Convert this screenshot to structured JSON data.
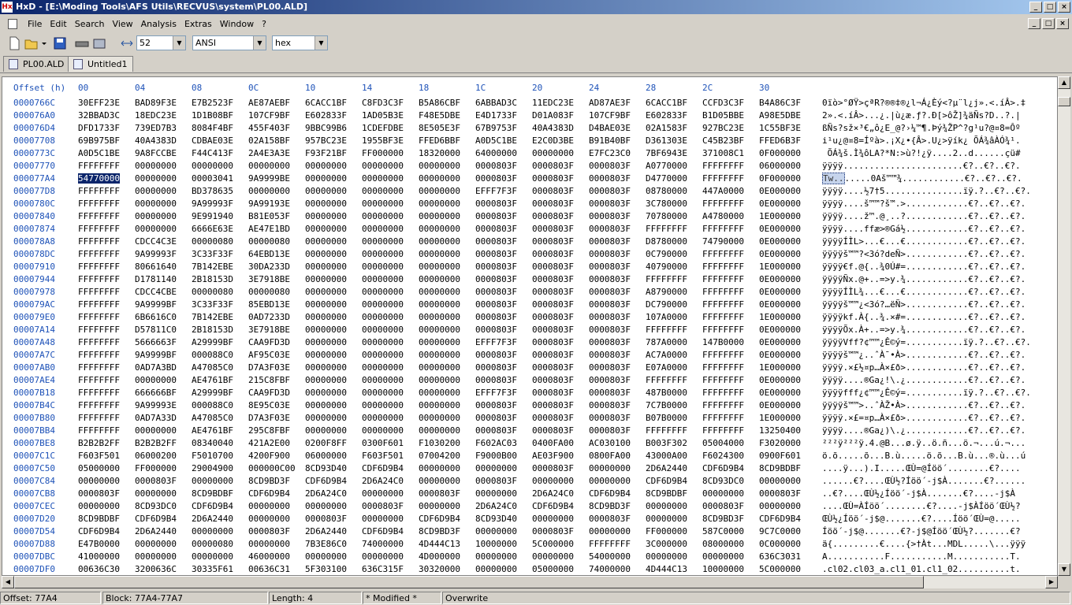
{
  "window": {
    "title": "HxD - [E:\\Moding Tools\\AFS Utils\\RECVUS\\system\\PL00.ALD]"
  },
  "menu": [
    "File",
    "Edit",
    "Search",
    "View",
    "Analysis",
    "Extras",
    "Window",
    "?"
  ],
  "toolbar": {
    "bytes_per_row": "52",
    "charset": "ANSI",
    "offset_base": "hex"
  },
  "tabs": [
    {
      "label": "PL00.ALD",
      "active": true
    },
    {
      "label": "Untitled1",
      "active": false
    }
  ],
  "editor": {
    "header": {
      "offset_label": "Offset (h)",
      "cols": [
        "00",
        "04",
        "08",
        "0C",
        "10",
        "14",
        "18",
        "1C",
        "20",
        "24",
        "28",
        "2C",
        "30"
      ]
    },
    "selected": {
      "row": 2,
      "col": 0,
      "text_sel": "Tw.."
    },
    "rows": [
      {
        "o": "0000766C",
        "h": [
          "30EFF23E",
          "BAD89F3E",
          "E7B2523F",
          "AE87AEBF",
          "6CACC1BF",
          "C8FD3C3F",
          "B5A86CBF",
          "6ABBAD3C",
          "11EDC23E",
          "AD87AE3F",
          "6CACC1BF",
          "CCFD3C3F",
          "B4A86C3F"
        ],
        "t": "0ïò>°ØŸ>çªR?®®‡®¿l¬Á¿Èý<?µ¨l¿j».<.íÂ>.‡"
      },
      {
        "o": "000076A0",
        "h": [
          "32BBAD3C",
          "18EDC23E",
          "1D1B08BF",
          "107CF9BF",
          "E602833F",
          "1AD05B3E",
          "F48E5DBE",
          "E4D1733F",
          "D01A083F",
          "107CF9BF",
          "E602833F",
          "B1D05BBE",
          "A98E5DBE"
        ],
        "t": "2».<.íÂ>...¿.|ù¿æ.ƒ?.Ð[>ôŽ]¾äÑs?D..?.|"
      },
      {
        "o": "000076D4",
        "h": [
          "DFD1733F",
          "739ED7B3",
          "8084F4BF",
          "455F403F",
          "9BBC99B6",
          "1CDEFDBE",
          "8E505E3F",
          "67B9753F",
          "40A4383D",
          "D4BAE03E",
          "02A1583F",
          "927BC23E",
          "1C55BF3E"
        ],
        "t": "ßÑs?sž×³€„ô¿E_@?›¼™¶.Þý¾ŽP^?g¹u?@¤8=Ôº"
      },
      {
        "o": "00007708",
        "h": [
          "69B975BF",
          "40A4383D",
          "CDBAE03E",
          "02A158BF",
          "957BC23E",
          "1955BF3E",
          "FFED6BBF",
          "A0D5C1BE",
          "E2C0D3BE",
          "B91B40BF",
          "D361303E",
          "C45B23BF",
          "FFED6B3F"
        ],
        "t": "i¹u¿@¤8=Íºà>.¡X¿•{Â>.U¿>ÿík¿ ÕÁ¾âÀÓ¾¹."
      },
      {
        "o": "0000773C",
        "h": [
          "A0D5C1BE",
          "9A8FCCBE",
          "F44C413F",
          "2A4E3A3E",
          "F93F21BF",
          "FF000000",
          "18320000",
          "64000000",
          "00000000",
          "E7FC23C0",
          "7BF6943E",
          "371008C1",
          "0F000000"
        ],
        "t": " ÕÁ¾š.Ì¾ôLA?*N:>ù?!¿ÿ....2..d......çü#"
      },
      {
        "o": "00007770",
        "h": [
          "FFFFFFFF",
          "00000000",
          "00000000",
          "00000000",
          "00000000",
          "00000000",
          "00000000",
          "0000803F",
          "0000803F",
          "0000803F",
          "A0770000",
          "FFFFFFFF",
          "06000000"
        ],
        "t": "ÿÿÿÿ.......................€?..€?..€?."
      },
      {
        "o": "000077A4",
        "h": [
          "54770000",
          "00000000",
          "00003041",
          "9A9999BE",
          "00000000",
          "00000000",
          "00000000",
          "0000803F",
          "0000803F",
          "0000803F",
          "D4770000",
          "FFFFFFFF",
          "0F000000"
        ],
        "t": "Tw.......0Aš™™¾............€?..€?..€?."
      },
      {
        "o": "000077D8",
        "h": [
          "FFFFFFFF",
          "00000000",
          "BD378635",
          "00000000",
          "00000000",
          "00000000",
          "00000000",
          "EFFF7F3F",
          "0000803F",
          "0000803F",
          "08780000",
          "447A0000",
          "0E000000"
        ],
        "t": "ÿÿÿÿ....½7†5...............ïÿ.?..€?..€?."
      },
      {
        "o": "0000780C",
        "h": [
          "FFFFFFFF",
          "00000000",
          "9A99993F",
          "9A99193E",
          "00000000",
          "00000000",
          "00000000",
          "0000803F",
          "0000803F",
          "0000803F",
          "3C780000",
          "FFFFFFFF",
          "0E000000"
        ],
        "t": "ÿÿÿÿ....š™™?š™.>............€?..€?..€?."
      },
      {
        "o": "00007840",
        "h": [
          "FFFFFFFF",
          "00000000",
          "9E991940",
          "B81E053F",
          "00000000",
          "00000000",
          "00000000",
          "0000803F",
          "0000803F",
          "0000803F",
          "70780000",
          "A4780000",
          "1E000000"
        ],
        "t": "ÿÿÿÿ....ž™.@¸..?............€?..€?..€?."
      },
      {
        "o": "00007874",
        "h": [
          "FFFFFFFF",
          "00000000",
          "6666E63E",
          "AE47E1BD",
          "00000000",
          "00000000",
          "00000000",
          "0000803F",
          "0000803F",
          "0000803F",
          "FFFFFFFF",
          "FFFFFFFF",
          "0E000000"
        ],
        "t": "ÿÿÿÿ....ffæ>®Gá½............€?..€?..€?."
      },
      {
        "o": "000078A8",
        "h": [
          "FFFFFFFF",
          "CDCC4C3E",
          "00000080",
          "00000080",
          "00000000",
          "00000000",
          "00000000",
          "0000803F",
          "0000803F",
          "0000803F",
          "D8780000",
          "74790000",
          "0E000000"
        ],
        "t": "ÿÿÿÿÍÌL>...€...€............€?..€?..€?."
      },
      {
        "o": "000078DC",
        "h": [
          "FFFFFFFF",
          "9A99993F",
          "3C33F33F",
          "64EBD13E",
          "00000000",
          "00000000",
          "00000000",
          "0000803F",
          "0000803F",
          "0000803F",
          "0C790000",
          "FFFFFFFF",
          "0E000000"
        ],
        "t": "ÿÿÿÿš™™?<3ó?deÑ>............€?..€?..€?."
      },
      {
        "o": "00007910",
        "h": [
          "FFFFFFFF",
          "80661640",
          "7B142EBE",
          "30DA233D",
          "00000000",
          "00000000",
          "00000000",
          "0000803F",
          "0000803F",
          "0000803F",
          "40790000",
          "FFFFFFFF",
          "1E000000"
        ],
        "t": "ÿÿÿÿ€f.@{..¾0Ú#=............€?..€?..€?."
      },
      {
        "o": "00007944",
        "h": [
          "FFFFFFFF",
          "D1781140",
          "2B18153D",
          "3E7918BE",
          "00000000",
          "00000000",
          "00000000",
          "0000803F",
          "0000803F",
          "0000803F",
          "FFFFFFFF",
          "FFFFFFFF",
          "0E000000"
        ],
        "t": "ÿÿÿÿÑx.@+..=>y.¾............€?..€?..€?."
      },
      {
        "o": "00007978",
        "h": [
          "FFFFFFFF",
          "CDCC4CBE",
          "00000080",
          "00000080",
          "00000000",
          "00000000",
          "00000000",
          "0000803F",
          "0000803F",
          "0000803F",
          "A8790000",
          "FFFFFFFF",
          "0E000000"
        ],
        "t": "ÿÿÿÿÍÌL¾...€...€............€?..€?..€?."
      },
      {
        "o": "000079AC",
        "h": [
          "FFFFFFFF",
          "9A9999BF",
          "3C33F33F",
          "85EBD13E",
          "00000000",
          "00000000",
          "00000000",
          "0000803F",
          "0000803F",
          "0000803F",
          "DC790000",
          "FFFFFFFF",
          "0E000000"
        ],
        "t": "ÿÿÿÿš™™¿<3ó?…ëÑ>............€?..€?..€?."
      },
      {
        "o": "000079E0",
        "h": [
          "FFFFFFFF",
          "6B6616C0",
          "7B142EBE",
          "0AD7233D",
          "00000000",
          "00000000",
          "00000000",
          "0000803F",
          "0000803F",
          "0000803F",
          "107A0000",
          "FFFFFFFF",
          "1E000000"
        ],
        "t": "ÿÿÿÿkf.À{..¾.×#=............€?..€?..€?."
      },
      {
        "o": "00007A14",
        "h": [
          "FFFFFFFF",
          "D57811C0",
          "2B18153D",
          "3E7918BE",
          "00000000",
          "00000000",
          "00000000",
          "0000803F",
          "0000803F",
          "0000803F",
          "FFFFFFFF",
          "FFFFFFFF",
          "0E000000"
        ],
        "t": "ÿÿÿÿÕx.À+..=>y.¾............€?..€?..€?."
      },
      {
        "o": "00007A48",
        "h": [
          "FFFFFFFF",
          "5666663F",
          "A29999BF",
          "CAA9FD3D",
          "00000000",
          "00000000",
          "00000000",
          "EFFF7F3F",
          "0000803F",
          "0000803F",
          "787A0000",
          "147B0000",
          "0E000000"
        ],
        "t": "ÿÿÿÿVff?¢™™¿Ê©ý=...........ïÿ.?..€?..€?."
      },
      {
        "o": "00007A7C",
        "h": [
          "FFFFFFFF",
          "9A9999BF",
          "000088C0",
          "AF95C03E",
          "00000000",
          "00000000",
          "00000000",
          "0000803F",
          "0000803F",
          "0000803F",
          "AC7A0000",
          "FFFFFFFF",
          "0E000000"
        ],
        "t": "ÿÿÿÿš™™¿..ˆÀ¯•À>............€?..€?..€?."
      },
      {
        "o": "00007AB0",
        "h": [
          "FFFFFFFF",
          "0AD7A3BD",
          "A47085C0",
          "D7A3F03E",
          "00000000",
          "00000000",
          "00000000",
          "0000803F",
          "0000803F",
          "0000803F",
          "E07A0000",
          "FFFFFFFF",
          "1E000000"
        ],
        "t": "ÿÿÿÿ.×£½¤p…À×£ð>............€?..€?..€?."
      },
      {
        "o": "00007AE4",
        "h": [
          "FFFFFFFF",
          "00000000",
          "AE4761BF",
          "215C8FBF",
          "00000000",
          "00000000",
          "00000000",
          "0000803F",
          "0000803F",
          "0000803F",
          "FFFFFFFF",
          "FFFFFFFF",
          "0E000000"
        ],
        "t": "ÿÿÿÿ....®Ga¿!\\.¿............€?..€?..€?."
      },
      {
        "o": "00007B18",
        "h": [
          "FFFFFFFF",
          "666666BF",
          "A29999BF",
          "CAA9FD3D",
          "00000000",
          "00000000",
          "00000000",
          "EFFF7F3F",
          "0000803F",
          "0000803F",
          "487B0000",
          "FFFFFFFF",
          "0E000000"
        ],
        "t": "ÿÿÿÿfff¿¢™™¿Ê©ý=...........ïÿ.?..€?..€?."
      },
      {
        "o": "00007B4C",
        "h": [
          "FFFFFFFF",
          "9A99993E",
          "000088C0",
          "8E95C03E",
          "00000000",
          "00000000",
          "00000000",
          "0000803F",
          "0000803F",
          "0000803F",
          "7C7B0000",
          "FFFFFFFF",
          "0E000000"
        ],
        "t": "ÿÿÿÿš™™>..ˆÀŽ•À>............€?..€?..€?."
      },
      {
        "o": "00007B80",
        "h": [
          "FFFFFFFF",
          "0AD7A33D",
          "A47085C0",
          "D7A3F03E",
          "00000000",
          "00000000",
          "00000000",
          "0000803F",
          "0000803F",
          "0000803F",
          "B07B0000",
          "FFFFFFFF",
          "1E000000"
        ],
        "t": "ÿÿÿÿ.×£=¤p…À×£ð>............€?..€?..€?."
      },
      {
        "o": "00007BB4",
        "h": [
          "FFFFFFFF",
          "00000000",
          "AE4761BF",
          "295C8FBF",
          "00000000",
          "00000000",
          "00000000",
          "0000803F",
          "0000803F",
          "0000803F",
          "FFFFFFFF",
          "FFFFFFFF",
          "13250400"
        ],
        "t": "ÿÿÿÿ....®Ga¿)\\.¿............€?..€?..€?."
      },
      {
        "o": "00007BE8",
        "h": [
          "B2B2B2FF",
          "B2B2B2FF",
          "08340040",
          "421A2E00",
          "0200F8FF",
          "0300F601",
          "F1030200",
          "F602AC03",
          "0400FA00",
          "AC030100",
          "B003F302",
          "05004000",
          "F3020000"
        ],
        "t": "²²²ÿ²²²ÿ.4.@B...ø.ÿ..ö.ñ...ö.¬...ú.¬..."
      },
      {
        "o": "00007C1C",
        "h": [
          "F603F501",
          "06000200",
          "F5010700",
          "4200F900",
          "06000000",
          "F603F501",
          "07004200",
          "F9000B00",
          "AE03F900",
          "0800FA00",
          "43000A00",
          "F6024300",
          "0900F601"
        ],
        "t": "ö.õ.....õ...B.ù.....ö.õ...B.ù...®.ù...ú"
      },
      {
        "o": "00007C50",
        "h": [
          "05000000",
          "FF000000",
          "29004900",
          "000000C00",
          "8CD93D40",
          "CDF6D9B4",
          "00000000",
          "00000000",
          "0000803F",
          "00000000",
          "2D6A2440",
          "CDF6D9B4",
          "8CD9BDBF"
        ],
        "t": "....ÿ...).I.....ŒÙ=@Íöö´........€?...."
      },
      {
        "o": "00007C84",
        "h": [
          "00000000",
          "0000803F",
          "00000000",
          "8CD9BD3F",
          "CDF6D9B4",
          "2D6A24C0",
          "00000000",
          "0000803F",
          "00000000",
          "00000000",
          "CDF6D9B4",
          "8CD93DC0",
          "00000000"
        ],
        "t": "......€?....ŒÙ½?Íöö´-j$À.......€?......"
      },
      {
        "o": "00007CB8",
        "h": [
          "0000803F",
          "00000000",
          "8CD9BDBF",
          "CDF6D9B4",
          "2D6A24C0",
          "00000000",
          "0000803F",
          "00000000",
          "2D6A24C0",
          "CDF6D9B4",
          "8CD9BDBF",
          "00000000",
          "0000803F"
        ],
        "t": "..€?....ŒÙ½¿Íöö´-j$À.......€?....-j$À"
      },
      {
        "o": "00007CEC",
        "h": [
          "00000000",
          "8CD93DC0",
          "CDF6D9B4",
          "00000000",
          "00000000",
          "0000803F",
          "00000000",
          "2D6A24C0",
          "CDF6D9B4",
          "8CD9BD3F",
          "00000000",
          "0000803F",
          "00000000"
        ],
        "t": "....ŒÙ=ÀÍöö´........€?....-j$ÀÍöö´ŒÙ½?"
      },
      {
        "o": "00007D20",
        "h": [
          "8CD9BDBF",
          "CDF6D9B4",
          "2D6A2440",
          "00000000",
          "0000803F",
          "00000000",
          "CDF6D9B4",
          "8CD93D40",
          "00000000",
          "0000803F",
          "00000000",
          "8CD9BD3F",
          "CDF6D9B4"
        ],
        "t": "ŒÙ½¿Íöö´-j$@.......€?....Íöö´ŒÙ=@....."
      },
      {
        "o": "00007D54",
        "h": [
          "CDF6D9B4",
          "2D6A2440",
          "00000000",
          "0000803F",
          "2D6A2440",
          "CDF6D9B4",
          "8CD9BD3F",
          "00000000",
          "0000803F",
          "00000000",
          "FF000000",
          "587C0000",
          "9C7C0000"
        ],
        "t": "Íöö´-j$@.......€?-j$@Íöö´ŒÙ½?.......€?"
      },
      {
        "o": "00007D88",
        "h": [
          "E47B0000",
          "00000000",
          "00000080",
          "00000000",
          "7B3E86C0",
          "74000000",
          "4D444C13",
          "10000000",
          "5C000000",
          "FFFFFFFF",
          "3C000000",
          "08000000",
          "0C000000"
        ],
        "t": "ä{.........€....{>†Àt...MDL.....\\...ÿÿÿ"
      },
      {
        "o": "00007DBC",
        "h": [
          "41000000",
          "00000000",
          "00000000",
          "46000000",
          "00000000",
          "00000000",
          "4D000000",
          "00000000",
          "00000000",
          "54000000",
          "00000000",
          "00000000",
          "636C3031"
        ],
        "t": "A...........F...........M...........T."
      },
      {
        "o": "00007DF0",
        "h": [
          "00636C30",
          "3200636C",
          "30335F61",
          "00636C31",
          "5F303100",
          "636C315F",
          "30320000",
          "00000000",
          "05000000",
          "74000000",
          "4D444C13",
          "10000000",
          "5C000000"
        ],
        "t": ".cl02.cl03_a.cl1_01.cl1_02..........t."
      }
    ]
  },
  "status": {
    "offset": "Offset: 77A4",
    "block": "Block: 77A4-77A7",
    "length": "Length: 4",
    "modified": "* Modified *",
    "mode": "Overwrite"
  }
}
